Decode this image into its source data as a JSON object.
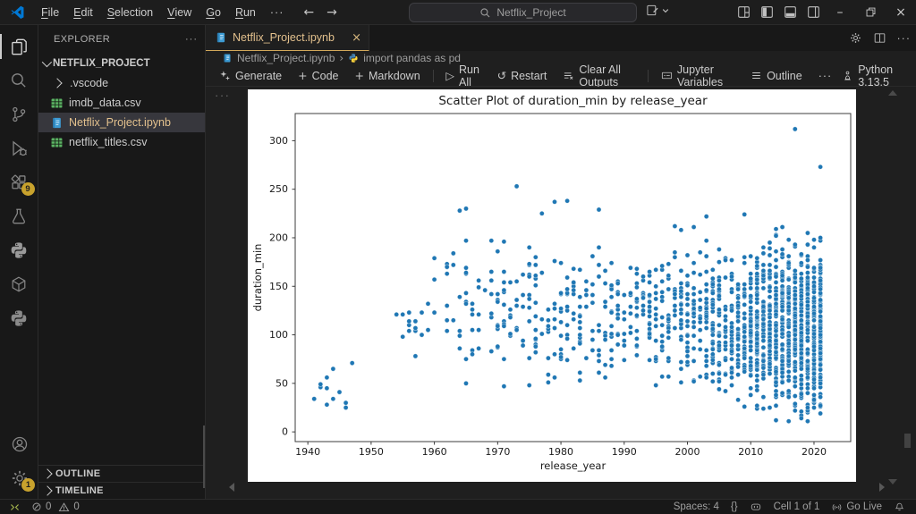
{
  "titlebar": {
    "menus": [
      "File",
      "Edit",
      "Selection",
      "View",
      "Go",
      "Run"
    ],
    "overflow": "···",
    "back": "←",
    "forward": "→",
    "search_text": "Netflix_Project"
  },
  "activity_bar": {
    "extensions_badge": "9",
    "settings_badge": "1"
  },
  "sidebar": {
    "header": "EXPLORER",
    "header_menu": "···",
    "root": "NETFLIX_PROJECT",
    "items": [
      {
        "label": ".vscode"
      },
      {
        "label": "imdb_data.csv"
      },
      {
        "label": "Netflix_Project.ipynb"
      },
      {
        "label": "netflix_titles.csv"
      }
    ],
    "outline": "OUTLINE",
    "timeline": "TIMELINE"
  },
  "tabbar": {
    "tab": "Netflix_Project.ipynb",
    "close": "×",
    "actions_overflow": "···"
  },
  "breadcrumb": {
    "file": "Netflix_Project.ipynb",
    "sep": "›",
    "cell": "import pandas as pd"
  },
  "toolbar": {
    "generate": "Generate",
    "plus": "+",
    "code": "Code",
    "markdown": "Markdown",
    "run_glyph": "▷",
    "run_all": "Run All",
    "restart_glyph": "↺",
    "restart": "Restart",
    "clear": "Clear All Outputs",
    "variables": "Jupyter Variables",
    "outline": "Outline",
    "overflow": "···",
    "kernel": "Python 3.13.5"
  },
  "cell": {
    "gutter": "···"
  },
  "statusbar": {
    "errors": "0",
    "warnings": "0",
    "spaces": "Spaces: 4",
    "braces": "{}",
    "cell": "Cell 1 of 1",
    "go_live": "Go Live"
  },
  "chart_data": {
    "type": "scatter",
    "title": "Scatter Plot of duration_min by release_year",
    "xlabel": "release_year",
    "ylabel": "duration_min",
    "xlim": [
      1938,
      2025.8
    ],
    "ylim": [
      -10,
      328
    ],
    "xticks": [
      1940,
      1950,
      1960,
      1970,
      1980,
      1990,
      2000,
      2010,
      2020
    ],
    "yticks": [
      0,
      50,
      100,
      150,
      200,
      250,
      300
    ],
    "grid": false,
    "legend": "none",
    "point_color": "#1f77b4",
    "point_edge": "#ffffff",
    "point_radius": 2.6,
    "seed": 11,
    "clusters": [
      {
        "years": [
          1941,
          1947
        ],
        "n": 13,
        "mean": 52,
        "std": 20,
        "min": 18,
        "max": 84
      },
      {
        "years": [
          1954,
          1958
        ],
        "n": 13,
        "mean": 106,
        "std": 12,
        "min": 72,
        "max": 124
      },
      {
        "years": [
          1959,
          1964
        ],
        "n": 20,
        "mean": 135,
        "std": 38,
        "min": 60,
        "max": 215
      },
      {
        "years": [
          1965,
          1969
        ],
        "n": 30,
        "mean": 128,
        "std": 34,
        "min": 45,
        "max": 229
      },
      {
        "years": [
          1970,
          1974
        ],
        "n": 38,
        "mean": 122,
        "std": 34,
        "min": 24,
        "max": 250
      },
      {
        "years": [
          1975,
          1979
        ],
        "n": 45,
        "mean": 122,
        "std": 33,
        "min": 45,
        "max": 230
      },
      {
        "years": [
          1980,
          1984
        ],
        "n": 48,
        "mean": 120,
        "std": 30,
        "min": 45,
        "max": 225
      },
      {
        "years": [
          1985,
          1989
        ],
        "n": 52,
        "mean": 122,
        "std": 30,
        "min": 45,
        "max": 228
      },
      {
        "years": [
          1990,
          1994
        ],
        "n": 60,
        "mean": 118,
        "std": 30,
        "min": 44,
        "max": 205
      },
      {
        "years": [
          1995,
          1999
        ],
        "n": 75,
        "mean": 118,
        "std": 30,
        "min": 44,
        "max": 215
      },
      {
        "years": [
          2000,
          2004
        ],
        "n": 110,
        "mean": 116,
        "std": 32,
        "min": 30,
        "max": 222
      },
      {
        "years": [
          2005,
          2009
        ],
        "n": 160,
        "mean": 112,
        "std": 34,
        "min": 25,
        "max": 215
      },
      {
        "years": [
          2010,
          2013
        ],
        "n": 230,
        "mean": 110,
        "std": 37,
        "min": 14,
        "max": 210
      },
      {
        "years": [
          2014,
          2017
        ],
        "n": 340,
        "mean": 106,
        "std": 40,
        "min": 10,
        "max": 212
      },
      {
        "years": [
          2018,
          2021
        ],
        "n": 400,
        "mean": 102,
        "std": 43,
        "min": 8,
        "max": 212
      }
    ],
    "outliers": [
      [
        1964,
        228
      ],
      [
        1965,
        230
      ],
      [
        1973,
        253
      ],
      [
        1979,
        237
      ],
      [
        1981,
        238
      ],
      [
        1986,
        229
      ],
      [
        2003,
        222
      ],
      [
        2009,
        224
      ],
      [
        2017,
        312
      ],
      [
        2021,
        273
      ]
    ]
  }
}
